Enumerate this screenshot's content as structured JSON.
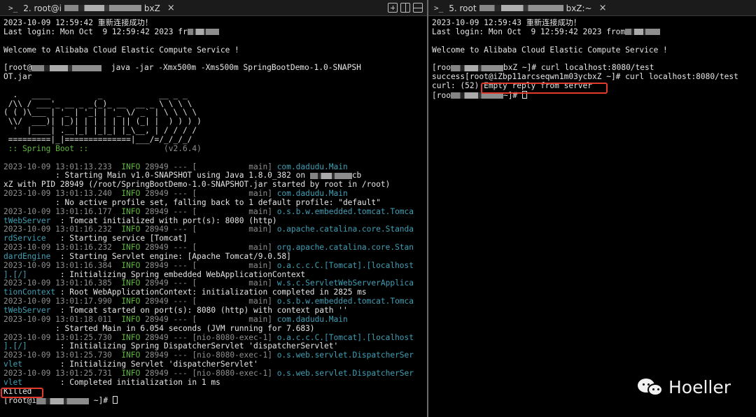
{
  "left_tab": {
    "prompt_glyph": ">_",
    "title": "2. root@i",
    "title_tail": "bxZ",
    "close": "×"
  },
  "right_tab": {
    "prompt_glyph": ">_",
    "title": "5. root",
    "title_tail": "bxZ:~",
    "close": "×"
  },
  "left_lines": [
    [
      {
        "t": "2023-10-09 12:59:42 重新连接成功！",
        "c": "white"
      }
    ],
    [
      {
        "t": "Last login: Mon Oct  9 12:59:42 2023 fr",
        "c": "white"
      },
      {
        "r": 90
      }
    ],
    [
      {
        "t": "",
        "c": "white"
      }
    ],
    [
      {
        "t": "Welcome to Alibaba Cloud Elastic Compute Service !",
        "c": "white"
      }
    ],
    [
      {
        "t": "",
        "c": "white"
      }
    ],
    [
      {
        "t": "[root@",
        "c": "white"
      },
      {
        "r": 200
      },
      {
        "t": "  java -jar -Xmx500m -Xms500m SpringBootDemo-1.0-SNAPSH",
        "c": "white"
      }
    ],
    [
      {
        "t": "OT.jar",
        "c": "white"
      }
    ],
    [
      {
        "t": "",
        "c": "white"
      }
    ],
    [
      {
        "t": "  .   ____          _            __ _ _",
        "c": "banner"
      }
    ],
    [
      {
        "t": " /\\\\ / ___'_ __ _ _(_)_ __  __ _ \\ \\ \\ \\",
        "c": "banner"
      }
    ],
    [
      {
        "t": "( ( )\\___ | '_ | '_| | '_ \\/ _` | \\ \\ \\ \\",
        "c": "banner"
      }
    ],
    [
      {
        "t": " \\\\/  ___)| |_)| | | | | || (_| |  ) ) ) )",
        "c": "banner"
      }
    ],
    [
      {
        "t": "  '  |____| .__|_| |_|_| |_\\__, | / / / /",
        "c": "banner"
      }
    ],
    [
      {
        "t": " =========|_|==============|___/=/_/_/_/",
        "c": "banner"
      }
    ],
    [
      {
        "t": " :: Spring Boot ::",
        "c": "green"
      },
      {
        "t": "                (v2.6.4)",
        "c": "gray"
      }
    ],
    [
      {
        "t": "",
        "c": "white"
      }
    ],
    [
      {
        "t": "2023-10-09 13:01:13.233  ",
        "c": "gray"
      },
      {
        "t": "INFO",
        "c": "green"
      },
      {
        "t": " 28949 ",
        "c": "gray"
      },
      {
        "t": "--- [           main] ",
        "c": "gray"
      },
      {
        "t": "com.dadudu.Main",
        "c": "cyan"
      }
    ],
    [
      {
        "t": "           : Starting Main v1.0-SNAPSHOT using Java 1.8.0_382 on ",
        "c": "white"
      },
      {
        "r": 120
      },
      {
        "t": "cb",
        "c": "white"
      }
    ],
    [
      {
        "t": "xZ with PID 28949 (/root/SpringBootDemo-1.0-SNAPSHOT.jar started by root in /root)",
        "c": "white"
      }
    ],
    [
      {
        "t": "2023-10-09 13:01:13.240  ",
        "c": "gray"
      },
      {
        "t": "INFO",
        "c": "green"
      },
      {
        "t": " 28949 ",
        "c": "gray"
      },
      {
        "t": "--- [           main] ",
        "c": "gray"
      },
      {
        "t": "com.dadudu.Main",
        "c": "cyan"
      }
    ],
    [
      {
        "t": "           : No active profile set, falling back to 1 default profile: \"default\"",
        "c": "white"
      }
    ],
    [
      {
        "t": "2023-10-09 13:01:16.177  ",
        "c": "gray"
      },
      {
        "t": "INFO",
        "c": "green"
      },
      {
        "t": " 28949 ",
        "c": "gray"
      },
      {
        "t": "--- [           main] ",
        "c": "gray"
      },
      {
        "t": "o.s.b.w.embedded.tomcat.Tomca",
        "c": "cyan"
      }
    ],
    [
      {
        "t": "tWebServer",
        "c": "cyan"
      },
      {
        "t": "  : Tomcat initialized with port(s): 8080 (http)",
        "c": "white"
      }
    ],
    [
      {
        "t": "2023-10-09 13:01:16.232  ",
        "c": "gray"
      },
      {
        "t": "INFO",
        "c": "green"
      },
      {
        "t": " 28949 ",
        "c": "gray"
      },
      {
        "t": "--- [           main] ",
        "c": "gray"
      },
      {
        "t": "o.apache.catalina.core.Standa",
        "c": "cyan"
      }
    ],
    [
      {
        "t": "rdService",
        "c": "cyan"
      },
      {
        "t": "   : Starting service [Tomcat]",
        "c": "white"
      }
    ],
    [
      {
        "t": "2023-10-09 13:01:16.232  ",
        "c": "gray"
      },
      {
        "t": "INFO",
        "c": "green"
      },
      {
        "t": " 28949 ",
        "c": "gray"
      },
      {
        "t": "--- [           main] ",
        "c": "gray"
      },
      {
        "t": "org.apache.catalina.core.Stan",
        "c": "cyan"
      }
    ],
    [
      {
        "t": "dardEngine",
        "c": "cyan"
      },
      {
        "t": "  : Starting Servlet engine: [Apache Tomcat/9.0.58]",
        "c": "white"
      }
    ],
    [
      {
        "t": "2023-10-09 13:01:16.384  ",
        "c": "gray"
      },
      {
        "t": "INFO",
        "c": "green"
      },
      {
        "t": " 28949 ",
        "c": "gray"
      },
      {
        "t": "--- [           main] ",
        "c": "gray"
      },
      {
        "t": "o.a.c.c.C.[Tomcat].[localhost",
        "c": "cyan"
      }
    ],
    [
      {
        "t": "].[/]",
        "c": "cyan"
      },
      {
        "t": "       : Initializing Spring embedded WebApplicationContext",
        "c": "white"
      }
    ],
    [
      {
        "t": "2023-10-09 13:01:16.385  ",
        "c": "gray"
      },
      {
        "t": "INFO",
        "c": "green"
      },
      {
        "t": " 28949 ",
        "c": "gray"
      },
      {
        "t": "--- [           main] ",
        "c": "gray"
      },
      {
        "t": "w.s.c.ServletWebServerApplica",
        "c": "cyan"
      }
    ],
    [
      {
        "t": "tionContext",
        "c": "cyan"
      },
      {
        "t": " : Root WebApplicationContext: initialization completed in 2825 ms",
        "c": "white"
      }
    ],
    [
      {
        "t": "2023-10-09 13:01:17.990  ",
        "c": "gray"
      },
      {
        "t": "INFO",
        "c": "green"
      },
      {
        "t": " 28949 ",
        "c": "gray"
      },
      {
        "t": "--- [           main] ",
        "c": "gray"
      },
      {
        "t": "o.s.b.w.embedded.tomcat.Tomca",
        "c": "cyan"
      }
    ],
    [
      {
        "t": "tWebServer",
        "c": "cyan"
      },
      {
        "t": "  : Tomcat started on port(s): 8080 (http) with context path ''",
        "c": "white"
      }
    ],
    [
      {
        "t": "2023-10-09 13:01:18.011  ",
        "c": "gray"
      },
      {
        "t": "INFO",
        "c": "green"
      },
      {
        "t": " 28949 ",
        "c": "gray"
      },
      {
        "t": "--- [           main] ",
        "c": "gray"
      },
      {
        "t": "com.dadudu.Main",
        "c": "cyan"
      }
    ],
    [
      {
        "t": "           : Started Main in 6.054 seconds (JVM running for 7.683)",
        "c": "white"
      }
    ],
    [
      {
        "t": "2023-10-09 13:01:25.730  ",
        "c": "gray"
      },
      {
        "t": "INFO",
        "c": "green"
      },
      {
        "t": " 28949 ",
        "c": "gray"
      },
      {
        "t": "--- [nio-8080-exec-1] ",
        "c": "gray"
      },
      {
        "t": "o.a.c.c.C.[Tomcat].[localhost",
        "c": "cyan"
      }
    ],
    [
      {
        "t": "].[/]",
        "c": "cyan"
      },
      {
        "t": "       : Initializing Spring DispatcherServlet 'dispatcherServlet'",
        "c": "white"
      }
    ],
    [
      {
        "t": "2023-10-09 13:01:25.730  ",
        "c": "gray"
      },
      {
        "t": "INFO",
        "c": "green"
      },
      {
        "t": " 28949 ",
        "c": "gray"
      },
      {
        "t": "--- [nio-8080-exec-1] ",
        "c": "gray"
      },
      {
        "t": "o.s.web.servlet.DispatcherSer",
        "c": "cyan"
      }
    ],
    [
      {
        "t": "vlet",
        "c": "cyan"
      },
      {
        "t": "        : Initializing Servlet 'dispatcherServlet'",
        "c": "white"
      }
    ],
    [
      {
        "t": "2023-10-09 13:01:25.731  ",
        "c": "gray"
      },
      {
        "t": "INFO",
        "c": "green"
      },
      {
        "t": " 28949 ",
        "c": "gray"
      },
      {
        "t": "--- [nio-8080-exec-1] ",
        "c": "gray"
      },
      {
        "t": "o.s.web.servlet.DispatcherSer",
        "c": "cyan"
      }
    ],
    [
      {
        "t": "vlet",
        "c": "cyan"
      },
      {
        "t": "        : Completed initialization in 1 ms",
        "c": "white"
      }
    ],
    [
      {
        "t": "Killed",
        "c": "white"
      }
    ],
    [
      {
        "t": "[root@i",
        "c": "white"
      },
      {
        "r": 150
      },
      {
        "t": " ~]# ",
        "c": "white"
      },
      {
        "cursor": true
      }
    ]
  ],
  "right_lines": [
    [
      {
        "t": "2023-10-09 12:59:43 重新连接成功！",
        "c": "white"
      }
    ],
    [
      {
        "t": "Last login: Mon Oct  9 12:59:42 2023 from",
        "c": "white"
      },
      {
        "r": 100
      }
    ],
    [
      {
        "t": "",
        "c": "white"
      }
    ],
    [
      {
        "t": "Welcome to Alibaba Cloud Elastic Compute Service !",
        "c": "white"
      }
    ],
    [
      {
        "t": "",
        "c": "white"
      }
    ],
    [
      {
        "t": "[roo",
        "c": "white"
      },
      {
        "r": 150
      },
      {
        "t": "bxZ ~]# curl localhost:8080/test",
        "c": "white"
      }
    ],
    [
      {
        "t": "success[root@iZbp11arcseqwn1m03ycbxZ ~]# curl localhost:8080/test",
        "c": "white"
      }
    ],
    [
      {
        "t": "curl: (52) Empty reply from server",
        "c": "white"
      }
    ],
    [
      {
        "t": "[roo",
        "c": "white"
      },
      {
        "r": 150
      },
      {
        "t": "~]# ",
        "c": "white"
      },
      {
        "cursor": true
      }
    ]
  ],
  "watermark": {
    "text": "Hoeller",
    "icon": "wechat-icon"
  },
  "highlights": {
    "color": "#e23b2e",
    "left": "Killed",
    "right": "Empty reply from server"
  }
}
